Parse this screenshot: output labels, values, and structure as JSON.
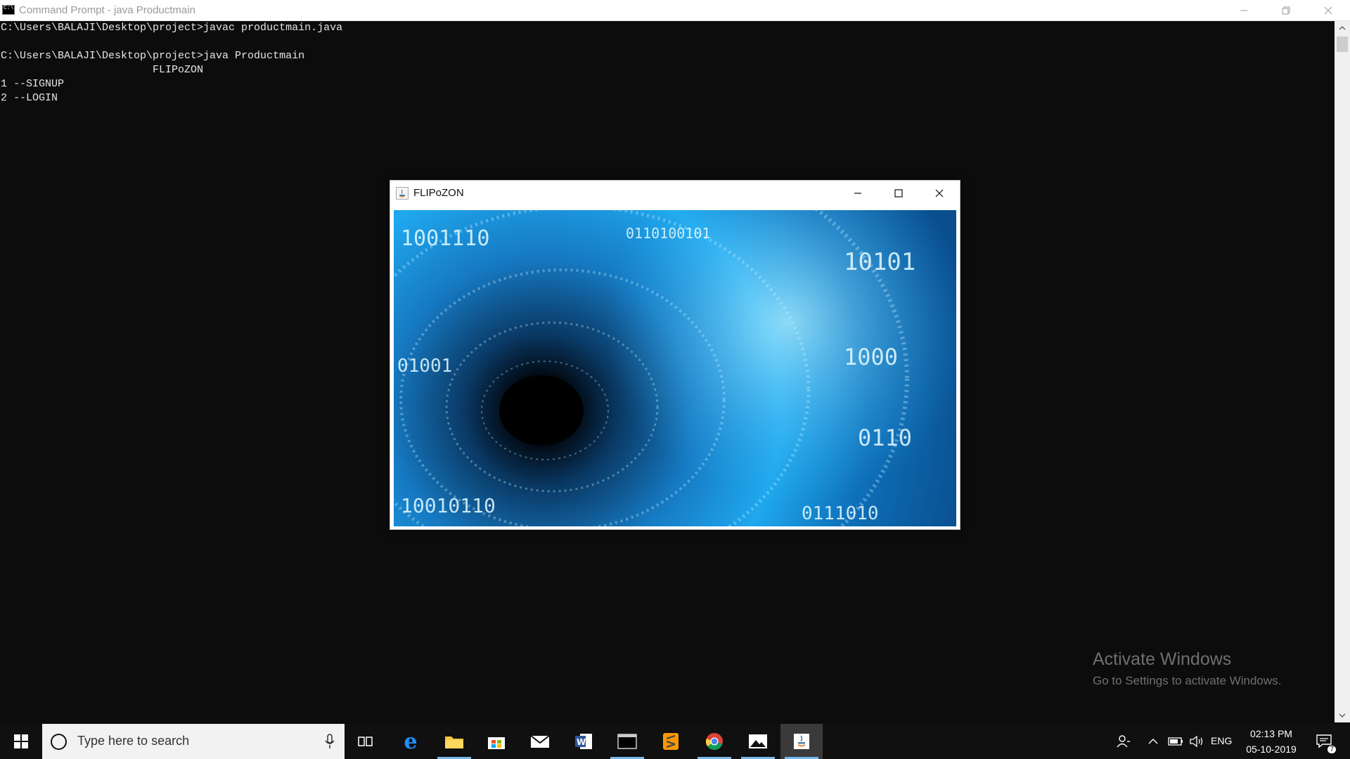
{
  "console": {
    "window_title": "Command Prompt - java  Productmain",
    "lines": [
      "C:\\Users\\BALAJI\\Desktop\\project>javac productmain.java",
      "",
      "C:\\Users\\BALAJI\\Desktop\\project>java Productmain",
      "                        FLIPoZON",
      "1 --SIGNUP",
      "2 --LOGIN"
    ]
  },
  "java_window": {
    "title": "FLIPoZON",
    "image_description_icon": "binary-tunnel-image"
  },
  "watermark": {
    "title": "Activate Windows",
    "subtitle": "Go to Settings to activate Windows."
  },
  "taskbar": {
    "search_placeholder": "Type here to search",
    "apps": [
      "task-view",
      "edge",
      "file-explorer",
      "store",
      "mail",
      "word",
      "command-prompt",
      "sublime-text",
      "chrome",
      "photos",
      "java"
    ],
    "language": "ENG",
    "time": "02:13 PM",
    "date": "05-10-2019",
    "notification_count": "7"
  },
  "colors": {
    "console_bg": "#0c0c0c",
    "console_text": "#e6e6e6",
    "taskbar_bg": "#101010",
    "accent": "#76b9ed"
  }
}
